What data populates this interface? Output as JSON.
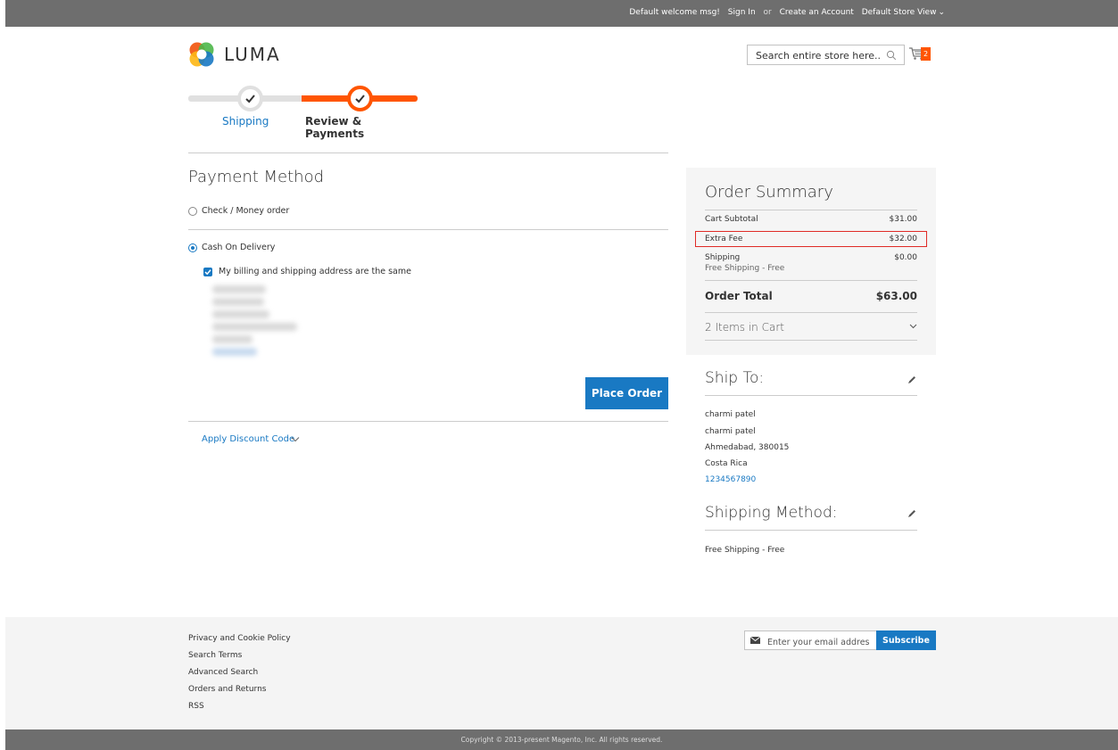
{
  "top_bar": {
    "welcome": "Default welcome msg!",
    "sign_in": "Sign In",
    "or": "or",
    "create_account": "Create an Account",
    "store_view": "Default Store View"
  },
  "header": {
    "logo_text": "LUMA",
    "search_placeholder": "Search entire store here...",
    "cart_count": "2"
  },
  "progress": {
    "step1_label": "Shipping",
    "step2_label": "Review & Payments"
  },
  "payment": {
    "title": "Payment Method",
    "option1": "Check / Money order",
    "option2": "Cash On Delivery",
    "same_address": "My billing and shipping address are the same",
    "place_order": "Place Order",
    "discount_link": "Apply Discount Code"
  },
  "summary": {
    "title": "Order Summary",
    "rows": [
      {
        "label": "Cart Subtotal",
        "value": "$31.00"
      },
      {
        "label": "Extra Fee",
        "value": "$32.00"
      },
      {
        "label": "Shipping",
        "sub": "Free Shipping - Free",
        "value": "$0.00"
      }
    ],
    "total_label": "Order Total",
    "total_value": "$63.00",
    "items_in_cart": "2 Items in Cart"
  },
  "ship_to": {
    "title": "Ship To:",
    "lines": [
      "charmi patel",
      "charmi patel",
      "Ahmedabad, 380015",
      "Costa Rica"
    ],
    "phone": "1234567890"
  },
  "shipping_method": {
    "title": "Shipping Method:",
    "value": "Free Shipping - Free"
  },
  "footer": {
    "links": [
      "Privacy and Cookie Policy",
      "Search Terms",
      "Advanced Search",
      "Orders and Returns",
      "RSS"
    ],
    "newsletter_placeholder": "Enter your email address",
    "subscribe": "Subscribe",
    "copyright": "Copyright © 2013-present Magento, Inc. All rights reserved."
  },
  "colors": {
    "accent": "#1979c3",
    "brand_orange": "#ff5501",
    "highlight_red": "#e02b27",
    "bar_gray": "#6e6e6e"
  }
}
